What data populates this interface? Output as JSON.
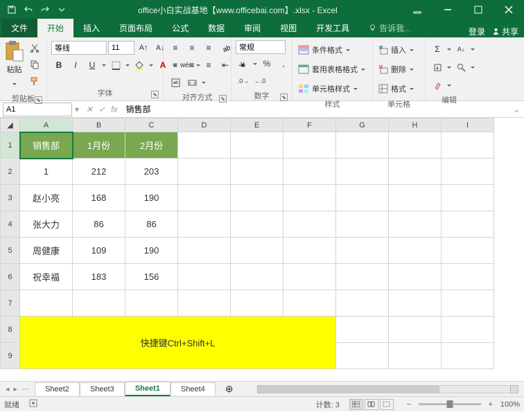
{
  "window": {
    "title": "office小白实战基地【www.officebai.com】.xlsx - Excel"
  },
  "tabs": {
    "file": "文件",
    "home": "开始",
    "insert": "插入",
    "layout": "页面布局",
    "formulas": "公式",
    "data": "数据",
    "review": "审阅",
    "view": "视图",
    "dev": "开发工具",
    "tell": "告诉我...",
    "login": "登录",
    "share": "共享"
  },
  "ribbon": {
    "clipboard": {
      "label": "剪贴板",
      "paste": "粘贴"
    },
    "font": {
      "label": "字体",
      "name": "等线",
      "size": "11"
    },
    "align": {
      "label": "对齐方式"
    },
    "number": {
      "label": "数字",
      "format": "常规"
    },
    "styles": {
      "label": "样式",
      "cond": "条件格式",
      "table": "套用表格格式",
      "cell": "单元格样式"
    },
    "cells": {
      "label": "单元格",
      "insert": "插入",
      "delete": "删除",
      "format": "格式"
    },
    "editing": {
      "label": "编辑"
    }
  },
  "fbar": {
    "name": "A1",
    "formula": "销售部"
  },
  "columns": [
    "A",
    "B",
    "C",
    "D",
    "E",
    "F",
    "G",
    "H",
    "I"
  ],
  "headers": [
    "销售部",
    "1月份",
    "2月份"
  ],
  "rows": [
    [
      "1",
      "212",
      "203"
    ],
    [
      "赵小亮",
      "168",
      "190"
    ],
    [
      "张大力",
      "86",
      "86"
    ],
    [
      "周健康",
      "109",
      "190"
    ],
    [
      "祝幸福",
      "183",
      "156"
    ]
  ],
  "note": "快捷键Ctrl+Shift+L",
  "sheets": {
    "s1": "Sheet2",
    "s2": "Sheet3",
    "s3": "Sheet1",
    "s4": "Sheet4"
  },
  "status": {
    "ready": "就绪",
    "count_lbl": "计数:",
    "count": "3",
    "zoom": "100%"
  },
  "chart_data": {
    "type": "table",
    "columns": [
      "销售部",
      "1月份",
      "2月份"
    ],
    "data": [
      {
        "销售部": "1",
        "1月份": 212,
        "2月份": 203
      },
      {
        "销售部": "赵小亮",
        "1月份": 168,
        "2月份": 190
      },
      {
        "销售部": "张大力",
        "1月份": 86,
        "2月份": 86
      },
      {
        "销售部": "周健康",
        "1月份": 109,
        "2月份": 190
      },
      {
        "销售部": "祝幸福",
        "1月份": 183,
        "2月份": 156
      }
    ]
  }
}
